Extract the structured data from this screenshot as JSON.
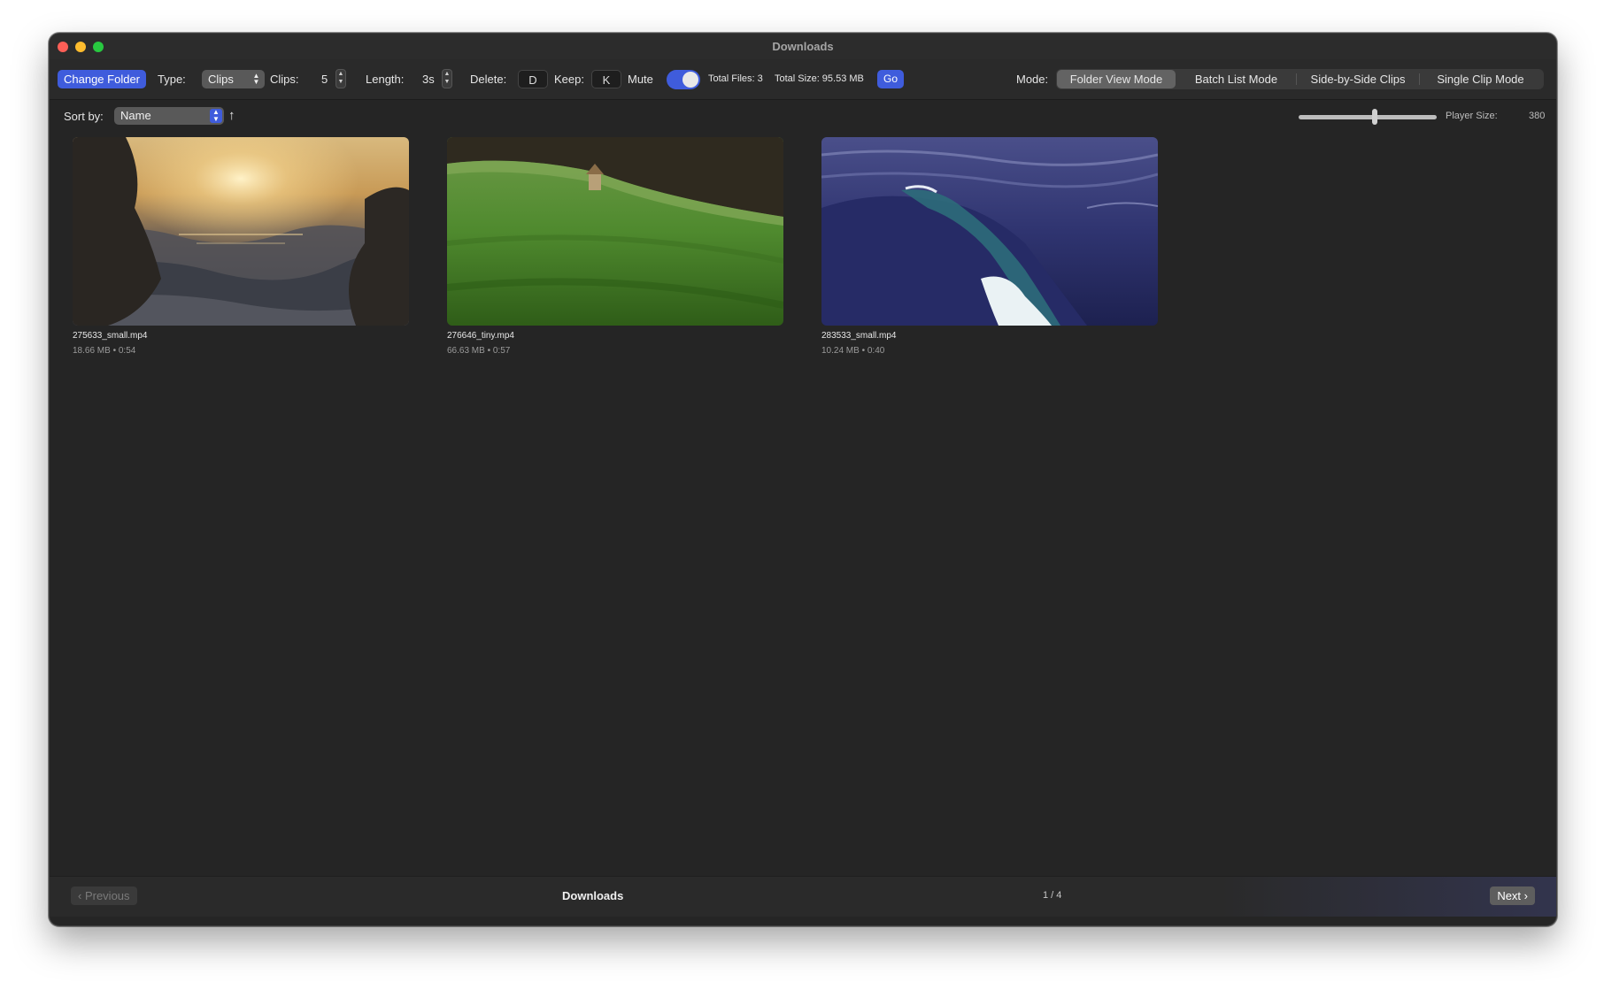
{
  "window": {
    "title": "Downloads"
  },
  "toolbar": {
    "change_folder_label": "Change Folder",
    "type_label": "Type:",
    "type_value": "Clips",
    "clips_label": "Clips:",
    "clips_value": "5",
    "length_label": "Length:",
    "length_value": "3s",
    "delete_label": "Delete:",
    "delete_key": "D",
    "keep_label": "Keep:",
    "keep_key": "K",
    "mute_label": "Mute",
    "mute_on": true,
    "total_files": "Total Files: 3",
    "total_size": "Total Size: 95.53 MB",
    "go_label": "Go",
    "mode_label": "Mode:",
    "modes": [
      {
        "label": "Folder View Mode",
        "active": true
      },
      {
        "label": "Batch List Mode",
        "active": false
      },
      {
        "label": "Side-by-Side Clips",
        "active": false
      },
      {
        "label": "Single Clip Mode",
        "active": false
      }
    ]
  },
  "sort": {
    "label": "Sort by:",
    "value": "Name",
    "direction_icon": "arrow-up-icon"
  },
  "player_size": {
    "label": "Player Size:",
    "value": "380"
  },
  "clips": [
    {
      "name": "275633_small.mp4",
      "meta": "18.66 MB • 0:54",
      "scene": "sunset-sea-rocks"
    },
    {
      "name": "276646_tiny.mp4",
      "meta": "66.63 MB • 0:57",
      "scene": "green-meadow-hut"
    },
    {
      "name": "283533_small.mp4",
      "meta": "10.24 MB • 0:40",
      "scene": "ocean-wave"
    }
  ],
  "footer": {
    "previous_label": "Previous",
    "folder_label": "Downloads",
    "page_indicator": "1 / 4",
    "next_label": "Next"
  },
  "colors": {
    "accent": "#3f5cdc",
    "window_bg": "#252525",
    "toolbar_bg": "#2a2a2a"
  }
}
